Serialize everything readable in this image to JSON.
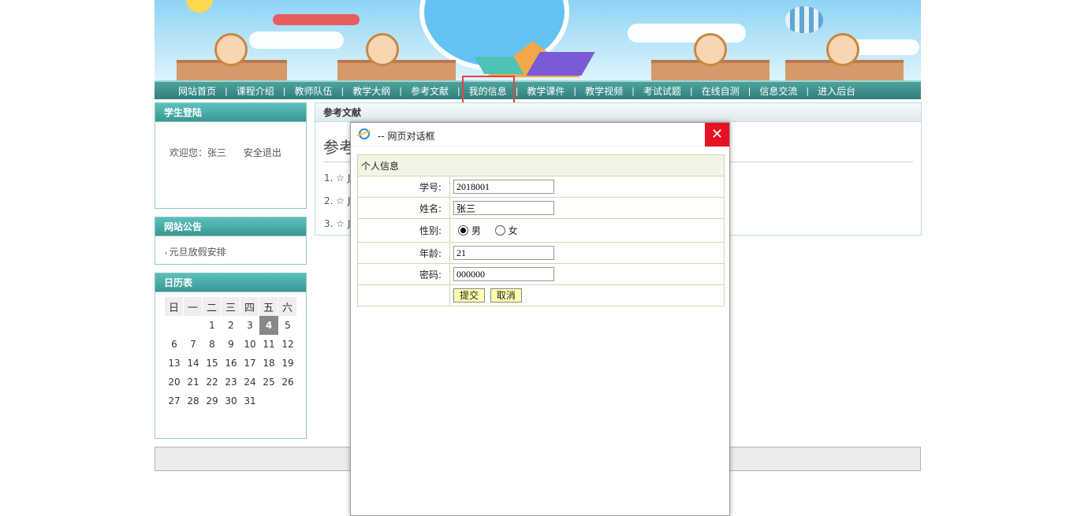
{
  "nav": {
    "items": [
      "网站首页",
      "课程介绍",
      "教师队伍",
      "教学大纲",
      "参考文献",
      "我的信息",
      "教学课件",
      "教学视频",
      "考试试题",
      "在线自测",
      "信息交流",
      "进入后台"
    ],
    "separator": "|"
  },
  "login_box": {
    "title": "学生登陆",
    "welcome": "欢迎您：张三",
    "logout": "安全退出"
  },
  "notice_box": {
    "title": "网站公告",
    "items": [
      "元旦放假安排"
    ]
  },
  "calendar": {
    "title": "日历表",
    "weekdays": [
      "日",
      "一",
      "二",
      "三",
      "四",
      "五",
      "六"
    ],
    "weeks": [
      [
        "",
        "",
        "",
        "1",
        "2",
        "3",
        "4",
        "5"
      ],
      [
        "6",
        "7",
        "8",
        "9",
        "10",
        "11",
        "12"
      ],
      [
        "13",
        "14",
        "15",
        "16",
        "17",
        "18",
        "19"
      ],
      [
        "20",
        "21",
        "22",
        "23",
        "24",
        "25",
        "26"
      ],
      [
        "27",
        "28",
        "29",
        "30",
        "31",
        "",
        ""
      ]
    ],
    "today": "4"
  },
  "main": {
    "header": "参考文献",
    "title": "参考",
    "list": [
      "1. ☆ J",
      "2. ☆ J",
      "3. ☆ J"
    ]
  },
  "dialog": {
    "title": "-- 网页对话框",
    "close": "✕",
    "section": "个人信息",
    "fields": {
      "student_id_label": "学号:",
      "student_id": "2018001",
      "name_label": "姓名:",
      "name": "张三",
      "gender_label": "性别:",
      "male": "男",
      "female": "女",
      "age_label": "年龄:",
      "age": "21",
      "password_label": "密码:",
      "password": "000000"
    },
    "submit": "提交",
    "cancel": "取消"
  }
}
